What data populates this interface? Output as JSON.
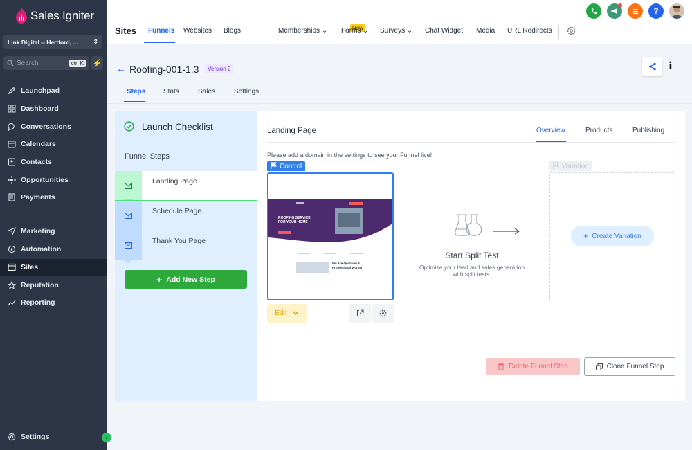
{
  "brand": {
    "name": "Sales Igniter",
    "accent": "#e11d7a"
  },
  "account": {
    "name": "Link Digital -- Hertford, ..."
  },
  "search": {
    "placeholder": "Search",
    "shortcut": "ctrl K"
  },
  "sidebar": {
    "items": [
      {
        "label": "Launchpad",
        "icon": "rocket-icon"
      },
      {
        "label": "Dashboard",
        "icon": "grid-icon"
      },
      {
        "label": "Conversations",
        "icon": "chat-icon"
      },
      {
        "label": "Calendars",
        "icon": "calendar-icon"
      },
      {
        "label": "Contacts",
        "icon": "contacts-icon"
      },
      {
        "label": "Opportunities",
        "icon": "hub-icon"
      },
      {
        "label": "Payments",
        "icon": "document-icon"
      },
      {
        "label": "Marketing",
        "icon": "send-icon"
      },
      {
        "label": "Automation",
        "icon": "automation-icon"
      },
      {
        "label": "Sites",
        "icon": "sites-icon",
        "active": true
      },
      {
        "label": "Reputation",
        "icon": "star-icon"
      },
      {
        "label": "Reporting",
        "icon": "chart-line-icon"
      }
    ],
    "settings_label": "Settings"
  },
  "topbar": {
    "module_title": "Sites",
    "nav": [
      "Funnels",
      "Websites",
      "Blogs",
      "Memberships",
      "Forms",
      "Surveys",
      "Chat Widget",
      "Media",
      "URL Redirects"
    ],
    "active_nav": "Funnels",
    "new_badge": "New"
  },
  "header": {
    "title": "Roofing-001-1.3",
    "version": "Version 2"
  },
  "subtabs": [
    "Steps",
    "Stats",
    "Sales",
    "Settings"
  ],
  "checklist": {
    "title": "Launch Checklist",
    "funnel_steps_title": "Funnel Steps",
    "steps": [
      "Landing Page",
      "Schedule Page",
      "Thank You Page"
    ],
    "add_step_label": "Add New Step"
  },
  "main": {
    "title": "Landing Page",
    "tabs": [
      "Overview",
      "Products",
      "Publishing"
    ],
    "active_tab": "Overview",
    "domain_message": "Please add a domain in the settings to see your Funnel live!",
    "control_label": "Control",
    "variation_label": "Variation",
    "edit_label": "Edit",
    "split_test_title": "Start Split Test",
    "split_test_sub": "Optimize your lead and sales generation with split tests.",
    "create_variation_label": "Create Variation",
    "delete_label": "Delete Funnel Step",
    "clone_label": "Clone Funnel Step"
  },
  "thumbnail": {
    "hero_line1": "ROOFING SERVICE",
    "hero_line2": "FOR YOUR HOME",
    "feature_line1": "We Are Qualified &",
    "feature_line2": "Professional Worker"
  },
  "colors": {
    "primary": "#2563eb",
    "green": "#2eaa3c",
    "sidebar_bg": "#2c3646",
    "danger": "#ef6a6a"
  }
}
